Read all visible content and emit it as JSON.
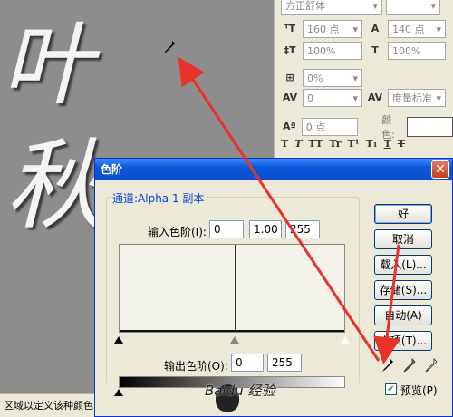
{
  "canvas": {
    "glyph_line1": "叶",
    "glyph_line2": "秋",
    "status_text": "区域以定义该种颜色"
  },
  "char_panel": {
    "font_family": "方正舒体",
    "font_size": "160 点",
    "leading": "140 点",
    "vscale": "100%",
    "hscale": "100%",
    "baseline_shift": "0%",
    "kerning": "0",
    "tracking": "度量标准",
    "shift": "0 点",
    "color_label": "颜色:",
    "styles": [
      "T",
      "T",
      "TT",
      "Tr",
      "T¹",
      "T₁",
      "T",
      "T"
    ]
  },
  "dialog": {
    "title": "色阶",
    "channel_label": "通道:Alpha 1 副本",
    "input_label": "输入色阶(I):",
    "input_black": "0",
    "input_gamma": "1.00",
    "input_white": "255",
    "output_label": "输出色阶(O):",
    "output_black": "0",
    "output_white": "255",
    "buttons": {
      "ok": "好",
      "cancel": "取消",
      "load": "载入(L)...",
      "save": "存储(S)...",
      "auto": "自动(A)",
      "options": "选项(T)..."
    },
    "preview_label": "预览(P)",
    "preview_checked": true
  },
  "watermark": "Baidu 经验",
  "icons": {
    "eyedropper": "eyedropper-icon",
    "close": "close-icon"
  },
  "colors": {
    "title_bar": "#0b57d9",
    "arrow": "#e8322a",
    "canvas": "#8d8d8d"
  }
}
